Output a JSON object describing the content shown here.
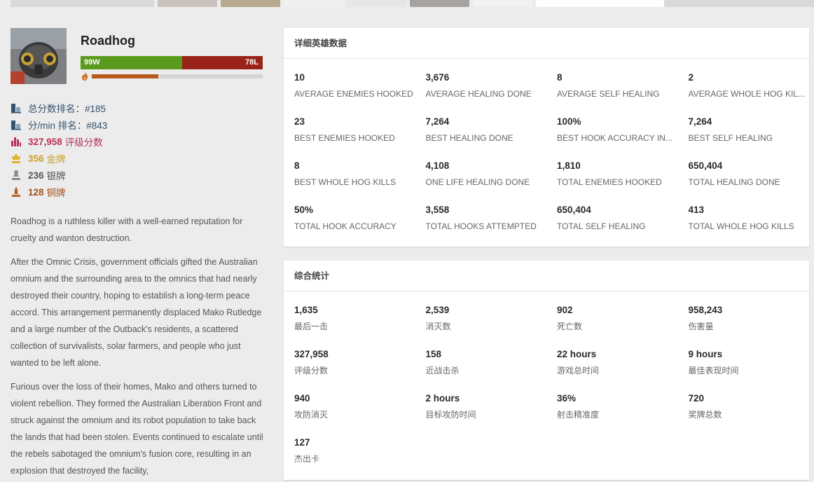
{
  "hero": {
    "name": "Roadhog",
    "wins": "99W",
    "losses": "78L",
    "win_fraction": 0.559,
    "streak_fraction": 0.39
  },
  "ranks": [
    {
      "icon": "rank-icon",
      "value": "",
      "label": "总分数排名：#185",
      "color": "#34536e"
    },
    {
      "icon": "rank-icon",
      "value": "",
      "label": "分/min 排名：#843",
      "color": "#34536e"
    },
    {
      "icon": "bar-chart-icon",
      "value": "327,958",
      "label": "评级分数",
      "color": "#b83257"
    },
    {
      "icon": "gold-medal-icon",
      "value": "356",
      "label": "金牌",
      "color": "#c9a227"
    },
    {
      "icon": "silver-medal-icon",
      "value": "236",
      "label": "银牌",
      "color": "#555555"
    },
    {
      "icon": "bronze-medal-icon",
      "value": "128",
      "label": "铜牌",
      "color": "#a0521d"
    }
  ],
  "bio": [
    "Roadhog is a ruthless killer with a well-earned reputation for cruelty and wanton destruction.",
    "After the Omnic Crisis, government officials gifted the Australian omnium and the surrounding area to the omnics that had nearly destroyed their country, hoping to establish a long-term peace accord. This arrangement permanently displaced Mako Rutledge and a large number of the Outback's residents, a scattered collection of survivalists, solar farmers, and people who just wanted to be left alone.",
    "Furious over the loss of their homes, Mako and others turned to violent rebellion. They formed the Australian Liberation Front and struck against the omnium and its robot population to take back the lands that had been stolen. Events continued to escalate until the rebels sabotaged the omnium's fusion core, resulting in an explosion that destroyed the facility,"
  ],
  "hero_stats": {
    "title": "详细英雄数据",
    "items": [
      {
        "value": "10",
        "label": "Average Enemies Hooked"
      },
      {
        "value": "3,676",
        "label": "Average Healing Done"
      },
      {
        "value": "8",
        "label": "Average Self Healing"
      },
      {
        "value": "2",
        "label": "Average Whole Hog Kil..."
      },
      {
        "value": "23",
        "label": "Best Enemies Hooked"
      },
      {
        "value": "7,264",
        "label": "Best Healing Done"
      },
      {
        "value": "100%",
        "label": "Best Hook Accuracy In..."
      },
      {
        "value": "7,264",
        "label": "Best Self Healing"
      },
      {
        "value": "8",
        "label": "Best Whole Hog Kills"
      },
      {
        "value": "4,108",
        "label": "One Life Healing Done"
      },
      {
        "value": "1,810",
        "label": "Total Enemies Hooked"
      },
      {
        "value": "650,404",
        "label": "Total Healing Done"
      },
      {
        "value": "50%",
        "label": "Total Hook Accuracy"
      },
      {
        "value": "3,558",
        "label": "Total Hooks Attempted"
      },
      {
        "value": "650,404",
        "label": "Total Self Healing"
      },
      {
        "value": "413",
        "label": "Total Whole Hog Kills"
      }
    ]
  },
  "general_stats": {
    "title": "综合统计",
    "items": [
      {
        "value": "1,635",
        "label": "最后一击"
      },
      {
        "value": "2,539",
        "label": "消灭数"
      },
      {
        "value": "902",
        "label": "死亡数"
      },
      {
        "value": "958,243",
        "label": "伤害量"
      },
      {
        "value": "327,958",
        "label": "评级分数"
      },
      {
        "value": "158",
        "label": "近战击杀"
      },
      {
        "value": "22 hours",
        "label": "游戏总时间"
      },
      {
        "value": "9 hours",
        "label": "最佳表现时间"
      },
      {
        "value": "940",
        "label": "攻防消灭"
      },
      {
        "value": "2 hours",
        "label": "目标攻防时间"
      },
      {
        "value": "36%",
        "label": "射击精准度"
      },
      {
        "value": "720",
        "label": "奖牌总数"
      },
      {
        "value": "127",
        "label": "杰出卡"
      }
    ]
  },
  "colors": {
    "win": "#5a9a1c",
    "loss": "#992219",
    "streak": "#b85a1e"
  }
}
